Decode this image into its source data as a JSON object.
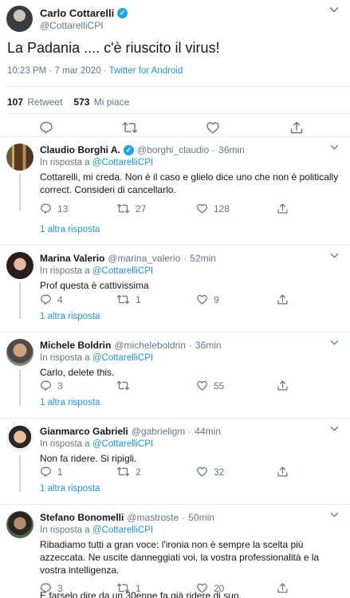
{
  "main_tweet": {
    "name": "Carlo Cottarelli",
    "handle": "@CottarelliCPI",
    "text": "La Padania .... c'è riuscito il virus!",
    "timestamp": "10:23 PM · 7 mar 2020",
    "separator": " · ",
    "source": "Twitter for Android",
    "retweets_count": "107",
    "retweets_label": "Retweet",
    "likes_count": "573",
    "likes_label": "Mi piace"
  },
  "in_reply_prefix": "In risposta a",
  "replies": [
    {
      "name": "Claudio Borghi A.",
      "handle": "@borghi_claudio",
      "time": "36min",
      "reply_to": "@CottarelliCPI",
      "text": "Cottarelli, mi creda. Non è il caso e glielo dice uno che non è politically correct. Consideri di cancellarlo.",
      "replies": "13",
      "retweets": "27",
      "likes": "128",
      "more": "1 altra risposta"
    },
    {
      "name": "Marina Valerio",
      "handle": "@marina_valerio",
      "time": "52min",
      "reply_to": "@CottarelliCPI",
      "text": "Prof questa è cattivissima",
      "replies": "4",
      "retweets": "1",
      "likes": "9",
      "more": "1 altra risposta"
    },
    {
      "name": "Michele Boldrin",
      "handle": "@micheleboldrin",
      "time": "36min",
      "reply_to": "@CottarelliCPI",
      "text": "Carlo, delete this.",
      "replies": "3",
      "retweets": "",
      "likes": "55",
      "more": "1 altra risposta"
    },
    {
      "name": "Gianmarco Gabrieli",
      "handle": "@gabrieligm",
      "time": "44min",
      "reply_to": "@CottarelliCPI",
      "text": "Non fa ridere. Si ripigli.",
      "replies": "1",
      "retweets": "2",
      "likes": "32",
      "more": "1 altra risposta"
    },
    {
      "name": "Stefano Bonomelli",
      "handle": "@mastroste",
      "time": "50min",
      "reply_to": "@CottarelliCPI",
      "text": "Ribadiamo tutti a gran voce: l'ironia non è sempre la scelta più azzeccata. Ne uscite danneggiati voi, la vostra professionalità e la vostra intelligenza.",
      "text2": "E farselo dire da un 30enne fa già ridere di suo.",
      "replies": "3",
      "retweets": "1",
      "likes": "20"
    }
  ],
  "colors": {
    "link": "#1b95e0",
    "secondary": "#657786",
    "border": "#e6ecf0",
    "verified": "#1da1f2"
  },
  "icons": [
    "reply-icon",
    "retweet-icon",
    "like-icon",
    "share-icon",
    "verified-icon",
    "chevron-down-icon"
  ]
}
